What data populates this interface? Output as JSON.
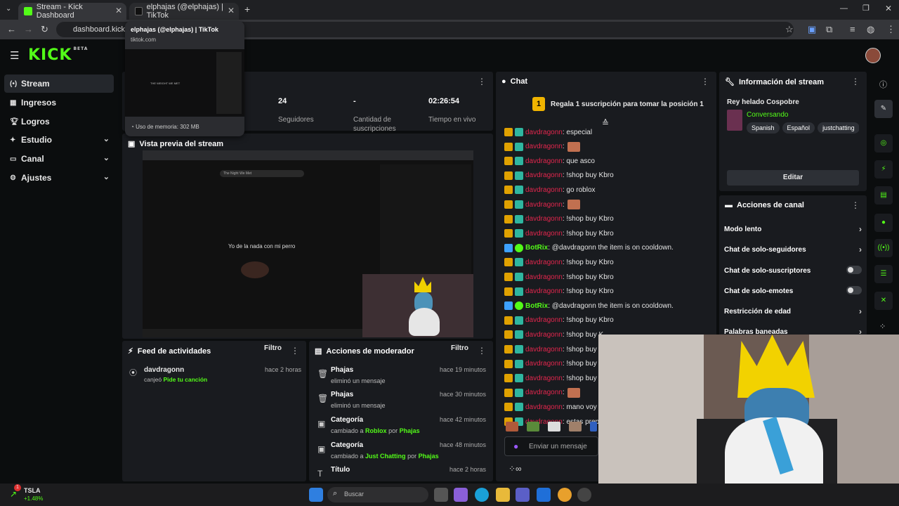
{
  "browser": {
    "tabs": [
      {
        "title": "Stream - Kick Dashboard",
        "active": true
      },
      {
        "title": "elphajas (@elphajas) | TikTok",
        "active": false
      }
    ],
    "url": "dashboard.kick.co",
    "tooltip": {
      "title": "elphajas (@elphajas) | TikTok",
      "domain": "tiktok.com",
      "memory": "Uso de memoria: 302 MB",
      "preview_caption": "THE WEIGHT WE MET"
    }
  },
  "brand": {
    "logo": "KICK",
    "beta": "BETA"
  },
  "sidebar": {
    "items": [
      {
        "label": "Stream"
      },
      {
        "label": "Ingresos"
      },
      {
        "label": "Logros"
      },
      {
        "label": "Estudio"
      },
      {
        "label": "Canal"
      },
      {
        "label": "Ajustes"
      }
    ]
  },
  "stats": [
    {
      "value": "24",
      "label": "Seguidores"
    },
    {
      "value": "-",
      "label": "Cantidad de suscripciones"
    },
    {
      "value": "02:26:54",
      "label": "Tiempo en vivo"
    }
  ],
  "preview": {
    "title": "Vista previa del stream",
    "subtitle": "Yo de la nada con mi perro",
    "search_text": "The Night We Met"
  },
  "activity": {
    "title": "Feed de actividades",
    "filter": "Filtro",
    "items": [
      {
        "user": "davdragonn",
        "time": "hace 2 horas",
        "pre": "canjeó",
        "reward": "Pide tu canción"
      }
    ]
  },
  "mod": {
    "title": "Acciones de moderador",
    "filter": "Filtro",
    "items": [
      {
        "title": "Phajas",
        "sub": "eliminó un mensaje",
        "time": "hace 19 minutos",
        "icon": "trash-icon"
      },
      {
        "title": "Phajas",
        "sub": "eliminó un mensaje",
        "time": "hace 30 minutos",
        "icon": "trash-icon"
      },
      {
        "title": "Categoría",
        "sub_pre": "cambiado a",
        "sub_val": "Roblox",
        "sub_by": "por",
        "sub_user": "Phajas",
        "time": "hace 42 minutos",
        "icon": "category-icon"
      },
      {
        "title": "Categoría",
        "sub_pre": "cambiado a",
        "sub_val": "Just Chatting",
        "sub_by": "por",
        "sub_user": "Phajas",
        "time": "hace 48 minutos",
        "icon": "category-icon"
      },
      {
        "title": "Título",
        "time": "hace 2 horas",
        "icon": "title-icon"
      }
    ]
  },
  "chat": {
    "title": "Chat",
    "pinned": {
      "rank": "1",
      "text": "Regala 1 suscripción para tomar la posición 1"
    },
    "messages": [
      {
        "user": "davdragonn",
        "text": ": especial",
        "bot": false
      },
      {
        "user": "davdragonn",
        "text": ":",
        "emote": true,
        "bot": false
      },
      {
        "user": "davdragonn",
        "text": ": que asco",
        "bot": false
      },
      {
        "user": "davdragonn",
        "text": ": !shop buy Kbro",
        "bot": false
      },
      {
        "user": "davdragonn",
        "text": ": go roblox",
        "bot": false
      },
      {
        "user": "davdragonn",
        "text": ":",
        "emote": true,
        "bot": false
      },
      {
        "user": "davdragonn",
        "text": ": !shop buy Kbro",
        "bot": false
      },
      {
        "user": "davdragonn",
        "text": ": !shop buy Kbro",
        "bot": false
      },
      {
        "user": "BotRix",
        "text": ": @davdragonn the item is on cooldown.",
        "bot": true
      },
      {
        "user": "davdragonn",
        "text": ": !shop buy Kbro",
        "bot": false
      },
      {
        "user": "davdragonn",
        "text": ": !shop buy Kbro",
        "bot": false
      },
      {
        "user": "davdragonn",
        "text": ": !shop buy Kbro",
        "bot": false
      },
      {
        "user": "BotRix",
        "text": ": @davdragonn the item is on cooldown.",
        "bot": true
      },
      {
        "user": "davdragonn",
        "text": ": !shop buy Kbro",
        "bot": false
      },
      {
        "user": "davdragonn",
        "text": ": !shop buy K",
        "bot": false
      },
      {
        "user": "davdragonn",
        "text": ": !shop buy K",
        "bot": false
      },
      {
        "user": "davdragonn",
        "text": ": !shop buy K",
        "bot": false
      },
      {
        "user": "davdragonn",
        "text": ": !shop buy K",
        "bot": false
      },
      {
        "user": "davdragonn",
        "text": ":",
        "emote": true,
        "bot": false
      },
      {
        "user": "davdragonn",
        "text": ": mano voy a",
        "bot": false
      },
      {
        "user": "davdragonn",
        "text": ": estas prepa",
        "bot": false
      }
    ],
    "input_placeholder": "Enviar un mensaje"
  },
  "info": {
    "title": "Información del stream",
    "stream_title": "Rey helado Cospobre",
    "category": "Conversando",
    "tags": [
      "Spanish",
      "Español",
      "justchatting"
    ],
    "edit": "Editar"
  },
  "actions": {
    "title": "Acciones de canal",
    "items": [
      {
        "label": "Modo lento",
        "kind": "arrow"
      },
      {
        "label": "Chat de solo-seguidores",
        "kind": "arrow"
      },
      {
        "label": "Chat de solo-suscriptores",
        "kind": "toggle"
      },
      {
        "label": "Chat de solo-emotes",
        "kind": "toggle"
      },
      {
        "label": "Restricción de edad",
        "kind": "arrow"
      },
      {
        "label": "Palabras baneadas",
        "kind": "arrow"
      }
    ]
  },
  "taskbar": {
    "ticker": "TSLA",
    "change": "+1.48%",
    "badge": "1",
    "search": "Buscar"
  },
  "colors": {
    "accent": "#53fc18",
    "username": "#e2264d",
    "panel": "#191b1f"
  }
}
